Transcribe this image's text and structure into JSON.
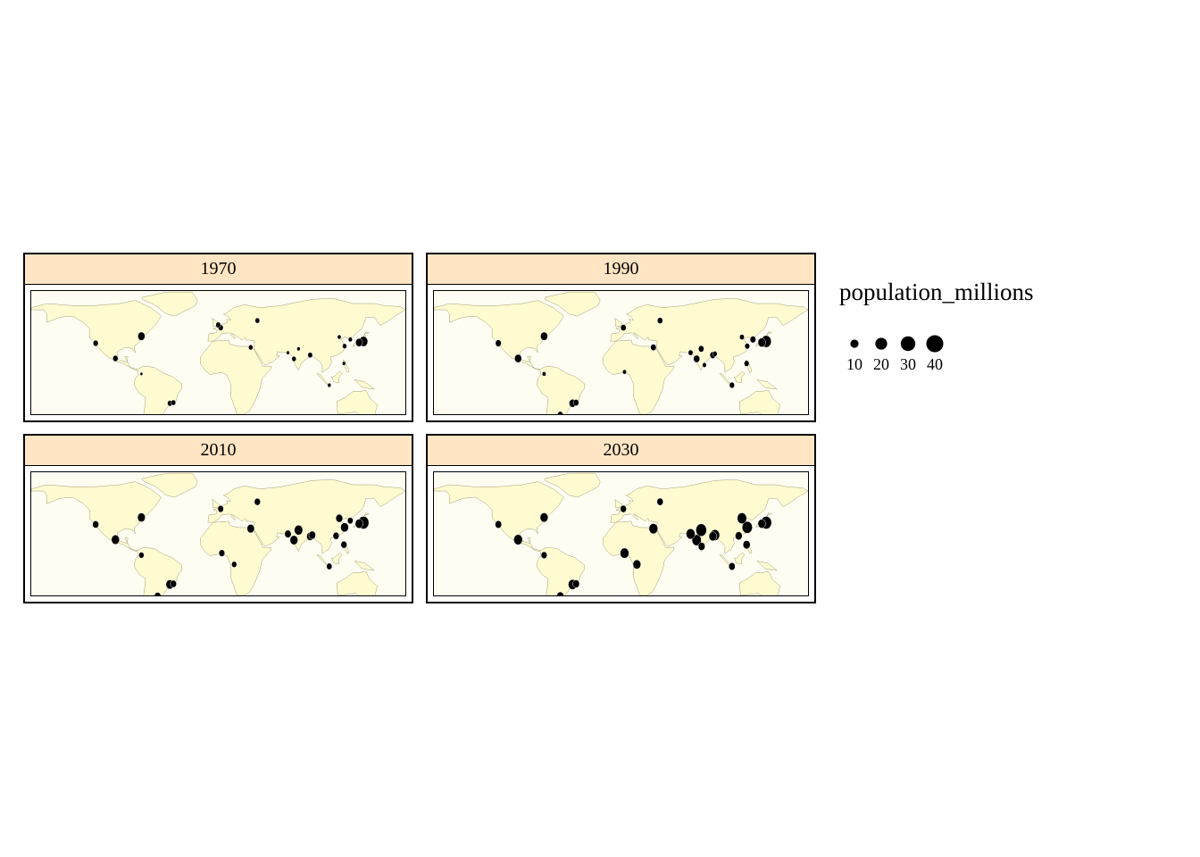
{
  "colors": {
    "land": "#fffbd1",
    "ocean": "#fffdf2",
    "border": "#8b8560",
    "header": "#ffe5c4",
    "bubble": "#000000",
    "bubble_edge": "#ffffff"
  },
  "legend": {
    "title": "population_millions",
    "items": [
      {
        "label": "10",
        "value": 10
      },
      {
        "label": "20",
        "value": 20
      },
      {
        "label": "30",
        "value": 30
      },
      {
        "label": "40",
        "value": 40
      }
    ]
  },
  "panels": [
    {
      "title": "1970",
      "cities": [
        {
          "lon": -74,
          "lat": 40.7,
          "pop": 16.2
        },
        {
          "lon": -118,
          "lat": 34,
          "pop": 8.4
        },
        {
          "lon": -99,
          "lat": 19.4,
          "pop": 8.8
        },
        {
          "lon": -74,
          "lat": 4.6,
          "pop": 2.4
        },
        {
          "lon": -46.6,
          "lat": -23.5,
          "pop": 7.6
        },
        {
          "lon": -43.2,
          "lat": -22.9,
          "pop": 6.8
        },
        {
          "lon": -0.1,
          "lat": 51.5,
          "pop": 7.5
        },
        {
          "lon": 2.3,
          "lat": 48.9,
          "pop": 8.2
        },
        {
          "lon": 37.6,
          "lat": 55.7,
          "pop": 6.7
        },
        {
          "lon": 31.2,
          "lat": 30,
          "pop": 6.1
        },
        {
          "lon": 72.8,
          "lat": 19,
          "pop": 6.2
        },
        {
          "lon": 77.2,
          "lat": 28.6,
          "pop": 3.5
        },
        {
          "lon": 88.4,
          "lat": 22.6,
          "pop": 7.1
        },
        {
          "lon": 67,
          "lat": 24.9,
          "pop": 3.1
        },
        {
          "lon": 116.4,
          "lat": 39.9,
          "pop": 4.4
        },
        {
          "lon": 121.5,
          "lat": 31.2,
          "pop": 6.0
        },
        {
          "lon": 139.7,
          "lat": 35.7,
          "pop": 23.3
        },
        {
          "lon": 135.5,
          "lat": 34.7,
          "pop": 15.3
        },
        {
          "lon": 127,
          "lat": 37.6,
          "pop": 5.3
        },
        {
          "lon": 106.8,
          "lat": -6.2,
          "pop": 3.9
        },
        {
          "lon": 120.9,
          "lat": 14.6,
          "pop": 3.5
        }
      ]
    },
    {
      "title": "1990",
      "cities": [
        {
          "lon": -74,
          "lat": 40.7,
          "pop": 16.1
        },
        {
          "lon": -118,
          "lat": 34,
          "pop": 10.9
        },
        {
          "lon": -99,
          "lat": 19.4,
          "pop": 15.6
        },
        {
          "lon": -74,
          "lat": 4.6,
          "pop": 4.7
        },
        {
          "lon": -46.6,
          "lat": -23.5,
          "pop": 14.8
        },
        {
          "lon": -43.2,
          "lat": -22.9,
          "pop": 9.7
        },
        {
          "lon": -58.4,
          "lat": -34.6,
          "pop": 10.5
        },
        {
          "lon": 2.3,
          "lat": 48.9,
          "pop": 9.3
        },
        {
          "lon": 37.6,
          "lat": 55.7,
          "pop": 9.0
        },
        {
          "lon": 31.2,
          "lat": 30,
          "pop": 9.9
        },
        {
          "lon": 3.4,
          "lat": 6.5,
          "pop": 4.8
        },
        {
          "lon": 72.8,
          "lat": 19,
          "pop": 12.4
        },
        {
          "lon": 77.2,
          "lat": 28.6,
          "pop": 9.7
        },
        {
          "lon": 88.4,
          "lat": 22.6,
          "pop": 10.9
        },
        {
          "lon": 90.4,
          "lat": 23.8,
          "pop": 6.6
        },
        {
          "lon": 67,
          "lat": 24.9,
          "pop": 7.1
        },
        {
          "lon": 80.3,
          "lat": 13.1,
          "pop": 5.3
        },
        {
          "lon": 116.4,
          "lat": 39.9,
          "pop": 6.8
        },
        {
          "lon": 121.5,
          "lat": 31.2,
          "pop": 7.8
        },
        {
          "lon": 139.7,
          "lat": 35.7,
          "pop": 32.5
        },
        {
          "lon": 135.5,
          "lat": 34.7,
          "pop": 18.4
        },
        {
          "lon": 127,
          "lat": 37.6,
          "pop": 10.5
        },
        {
          "lon": 106.8,
          "lat": -6.2,
          "pop": 8.2
        },
        {
          "lon": 120.9,
          "lat": 14.6,
          "pop": 8.0
        }
      ]
    },
    {
      "title": "2010",
      "cities": [
        {
          "lon": -74,
          "lat": 40.7,
          "pop": 18.4
        },
        {
          "lon": -118,
          "lat": 34,
          "pop": 12.2
        },
        {
          "lon": -99,
          "lat": 19.4,
          "pop": 20.1
        },
        {
          "lon": -74,
          "lat": 4.6,
          "pop": 8.5
        },
        {
          "lon": -46.6,
          "lat": -23.5,
          "pop": 19.7
        },
        {
          "lon": -43.2,
          "lat": -22.9,
          "pop": 11.9
        },
        {
          "lon": -58.4,
          "lat": -34.6,
          "pop": 13.1
        },
        {
          "lon": 2.3,
          "lat": 48.9,
          "pop": 10.5
        },
        {
          "lon": 37.6,
          "lat": 55.7,
          "pop": 11.5
        },
        {
          "lon": 31.2,
          "lat": 30,
          "pop": 16.9
        },
        {
          "lon": 3.4,
          "lat": 6.5,
          "pop": 10.8
        },
        {
          "lon": 15.3,
          "lat": -4.3,
          "pop": 8.4
        },
        {
          "lon": 72.8,
          "lat": 19,
          "pop": 19.4
        },
        {
          "lon": 77.2,
          "lat": 28.6,
          "pop": 22.0
        },
        {
          "lon": 88.4,
          "lat": 22.6,
          "pop": 15.6
        },
        {
          "lon": 90.4,
          "lat": 23.8,
          "pop": 14.7
        },
        {
          "lon": 67,
          "lat": 24.9,
          "pop": 13.5
        },
        {
          "lon": 116.4,
          "lat": 39.9,
          "pop": 15.0
        },
        {
          "lon": 121.5,
          "lat": 31.2,
          "pop": 19.6
        },
        {
          "lon": 113.3,
          "lat": 23.1,
          "pop": 11.8
        },
        {
          "lon": 139.7,
          "lat": 35.7,
          "pop": 36.9
        },
        {
          "lon": 135.5,
          "lat": 34.7,
          "pop": 19.3
        },
        {
          "lon": 127,
          "lat": 37.6,
          "pop": 9.8
        },
        {
          "lon": 106.8,
          "lat": -6.2,
          "pop": 9.6
        },
        {
          "lon": 120.9,
          "lat": 14.6,
          "pop": 11.6
        }
      ]
    },
    {
      "title": "2030",
      "cities": [
        {
          "lon": -74,
          "lat": 40.7,
          "pop": 19.9
        },
        {
          "lon": -118,
          "lat": 34,
          "pop": 13.3
        },
        {
          "lon": -99,
          "lat": 19.4,
          "pop": 24.1
        },
        {
          "lon": -74,
          "lat": 4.6,
          "pop": 11.0
        },
        {
          "lon": -46.6,
          "lat": -23.5,
          "pop": 23.4
        },
        {
          "lon": -43.2,
          "lat": -22.9,
          "pop": 14.4
        },
        {
          "lon": -58.4,
          "lat": -34.6,
          "pop": 16.0
        },
        {
          "lon": 2.3,
          "lat": 48.9,
          "pop": 11.8
        },
        {
          "lon": 37.6,
          "lat": 55.7,
          "pop": 12.2
        },
        {
          "lon": 31.2,
          "lat": 30,
          "pop": 24.5
        },
        {
          "lon": 3.4,
          "lat": 6.5,
          "pop": 24.2
        },
        {
          "lon": 15.3,
          "lat": -4.3,
          "pop": 19.4
        },
        {
          "lon": 72.8,
          "lat": 19,
          "pop": 27.8
        },
        {
          "lon": 77.2,
          "lat": 28.6,
          "pop": 36.1
        },
        {
          "lon": 88.4,
          "lat": 22.6,
          "pop": 19.1
        },
        {
          "lon": 90.4,
          "lat": 23.8,
          "pop": 28.1
        },
        {
          "lon": 67,
          "lat": 24.9,
          "pop": 24.8
        },
        {
          "lon": 77.6,
          "lat": 13,
          "pop": 14.8
        },
        {
          "lon": 116.4,
          "lat": 39.9,
          "pop": 27.7
        },
        {
          "lon": 121.5,
          "lat": 31.2,
          "pop": 32.9
        },
        {
          "lon": 113.3,
          "lat": 23.1,
          "pop": 15.4
        },
        {
          "lon": 139.7,
          "lat": 35.7,
          "pop": 37.2
        },
        {
          "lon": 135.5,
          "lat": 34.7,
          "pop": 18.7
        },
        {
          "lon": 106.8,
          "lat": -6.2,
          "pop": 13.0
        },
        {
          "lon": 120.9,
          "lat": 14.6,
          "pop": 16.3
        }
      ]
    }
  ]
}
